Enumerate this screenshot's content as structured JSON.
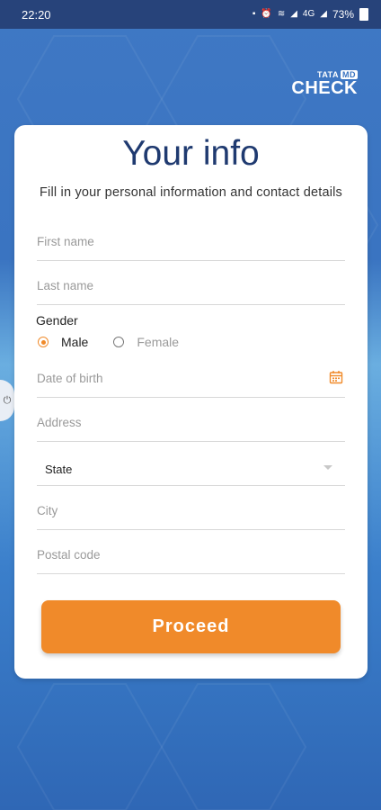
{
  "status": {
    "time": "22:20",
    "battery": "73%",
    "network": "4G"
  },
  "logo": {
    "top_left": "TATA",
    "top_badge": "MD",
    "main": "CHECK"
  },
  "form": {
    "title": "Your info",
    "subtitle": "Fill in your personal information and contact details",
    "first_name": {
      "placeholder": "First name"
    },
    "last_name": {
      "placeholder": "Last name"
    },
    "gender": {
      "label": "Gender",
      "options": [
        "Male",
        "Female"
      ],
      "selected": "Male"
    },
    "dob": {
      "placeholder": "Date of birth"
    },
    "address": {
      "placeholder": "Address"
    },
    "state": {
      "value": "State"
    },
    "city": {
      "placeholder": "City"
    },
    "postal": {
      "placeholder": "Postal code"
    },
    "proceed_label": "Proceed"
  },
  "colors": {
    "accent": "#f08a2a",
    "title": "#1f3a70",
    "statusbar": "#27437a"
  }
}
